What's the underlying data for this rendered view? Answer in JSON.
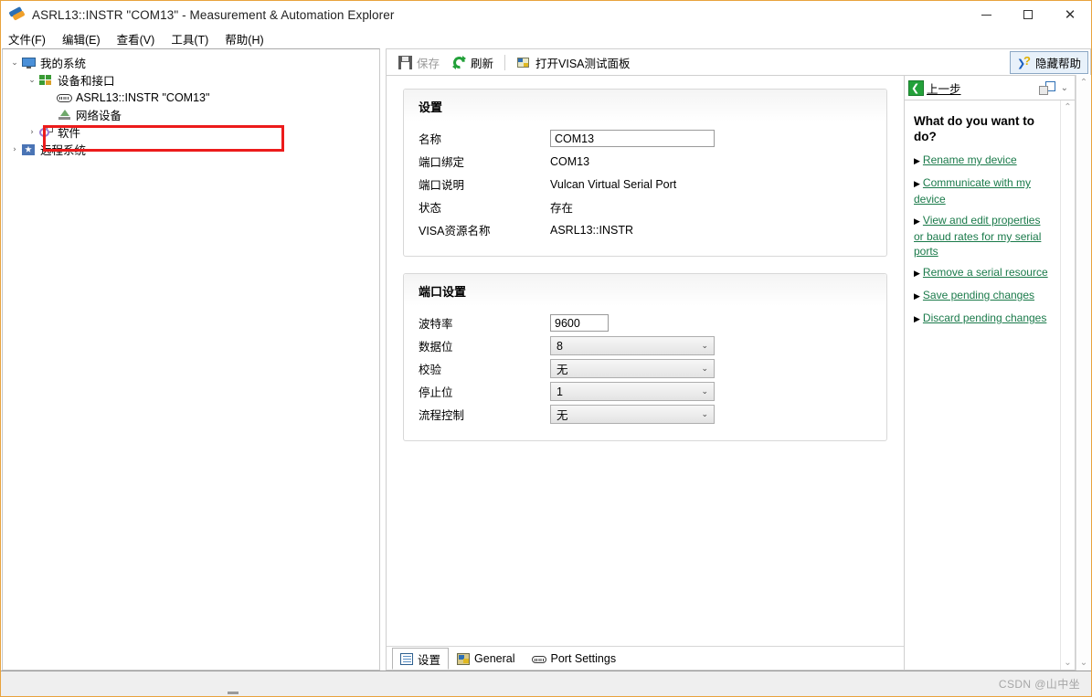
{
  "window": {
    "title": "ASRL13::INSTR \"COM13\" - Measurement & Automation Explorer",
    "app_icon": "ni-max-icon",
    "controls": {
      "minimize": "—",
      "maximize": "□",
      "close": "✕"
    }
  },
  "menubar": {
    "items": [
      {
        "label": "文件(F)",
        "name": "menu-file"
      },
      {
        "label": "编辑(E)",
        "name": "menu-edit"
      },
      {
        "label": "查看(V)",
        "name": "menu-view"
      },
      {
        "label": "工具(T)",
        "name": "menu-tools"
      },
      {
        "label": "帮助(H)",
        "name": "menu-help"
      }
    ]
  },
  "tree": {
    "items": [
      {
        "label": "我的系统",
        "icon": "monitor-icon",
        "expander": "⌄",
        "indent": 1,
        "selected": false
      },
      {
        "label": "设备和接口",
        "icon": "devices-interfaces-icon",
        "expander": "⌄",
        "indent": 2,
        "selected": false
      },
      {
        "label": "ASRL13::INSTR \"COM13\"",
        "icon": "serial-port-icon",
        "expander": "",
        "indent": 3,
        "selected": true
      },
      {
        "label": "网络设备",
        "icon": "network-device-icon",
        "expander": "",
        "indent": 3,
        "selected": false
      },
      {
        "label": "软件",
        "icon": "software-icon",
        "expander": "›",
        "indent": 2,
        "selected": false
      },
      {
        "label": "远程系统",
        "icon": "remote-systems-icon",
        "expander": "›",
        "indent": 1,
        "selected": false
      }
    ],
    "annotation_color": "#ec1b1b"
  },
  "toolbar": {
    "save_label": "保存",
    "refresh_label": "刷新",
    "open_visa_label": "打开VISA测试面板",
    "hide_help_label": "隐藏帮助"
  },
  "settings_panel": {
    "title": "设置",
    "name_label": "名称",
    "name_value": "COM13",
    "rows": [
      {
        "label": "端口绑定",
        "value": "COM13"
      },
      {
        "label": "端口说明",
        "value": "Vulcan Virtual Serial Port"
      },
      {
        "label": "状态",
        "value": "存在"
      },
      {
        "label": "VISA资源名称",
        "value": "ASRL13::INSTR"
      }
    ]
  },
  "port_settings_panel": {
    "title": "端口设置",
    "baud_label": "波特率",
    "baud_value": "9600",
    "selects": [
      {
        "label": "数据位",
        "value": "8"
      },
      {
        "label": "校验",
        "value": "无"
      },
      {
        "label": "停止位",
        "value": "1"
      },
      {
        "label": "流程控制",
        "value": "无"
      }
    ],
    "caret": "⌄"
  },
  "bottom_tabs": {
    "tabs": [
      {
        "label": "设置",
        "icon": "settings-tab-icon",
        "active": true
      },
      {
        "label": "General",
        "icon": "general-tab-icon",
        "active": false
      },
      {
        "label": "Port Settings",
        "icon": "port-settings-tab-icon",
        "active": false
      }
    ]
  },
  "help_panel": {
    "back_label": "上一步",
    "caret": "⌄",
    "title": "What do you want to do?",
    "link_color": "#1a7a4a",
    "bullet": "▶",
    "links": [
      "Rename my device",
      "Communicate with my device",
      "View and edit properties or baud rates for my serial ports",
      "Remove a serial resource",
      "Save pending changes",
      "Discard pending changes"
    ],
    "scroll_up": "⌃",
    "scroll_down": "⌄"
  },
  "scrollbar": {
    "up": "⌃",
    "down": "⌄"
  },
  "statusbar": {
    "watermark": "CSDN @山中坐"
  }
}
